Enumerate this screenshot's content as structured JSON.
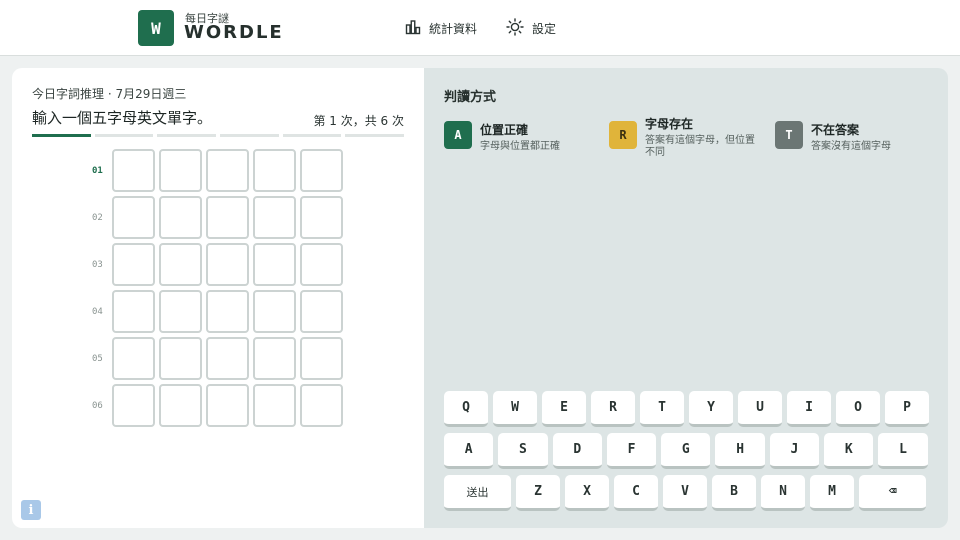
{
  "header": {
    "logo_letter": "W",
    "logo_sub": "每日字謎",
    "logo_title": "WORDLE",
    "nav_stats": "統計資料",
    "nav_settings": "設定"
  },
  "game": {
    "date_line": "今日字詞推理 · 7月29日週三",
    "prompt": "輸入一個五字母英文單字。",
    "attempts": "第 1 次，共 6 次",
    "current_row": 1,
    "row_labels": [
      "01",
      "02",
      "03",
      "04",
      "05",
      "06"
    ],
    "info_label": "i"
  },
  "legend": {
    "title": "判讀方式",
    "items": [
      {
        "letter": "A",
        "name": "位置正確",
        "desc": "字母與位置都正確",
        "color": "#1f6e4e"
      },
      {
        "letter": "R",
        "name": "字母存在",
        "desc": "答案有這個字母，但位置不同",
        "color": "#e0b43a"
      },
      {
        "letter": "T",
        "name": "不在答案",
        "desc": "答案沒有這個字母",
        "color": "#6b7674"
      }
    ]
  },
  "keyboard": {
    "row1": [
      "Q",
      "W",
      "E",
      "R",
      "T",
      "Y",
      "U",
      "I",
      "O",
      "P"
    ],
    "row2": [
      "A",
      "S",
      "D",
      "F",
      "G",
      "H",
      "J",
      "K",
      "L"
    ],
    "row3": [
      "送出",
      "Z",
      "X",
      "C",
      "V",
      "B",
      "N",
      "M",
      "⌫"
    ]
  },
  "colors": {
    "accent": "#1f6e4e",
    "present": "#e0b43a",
    "absent": "#6b7674"
  }
}
